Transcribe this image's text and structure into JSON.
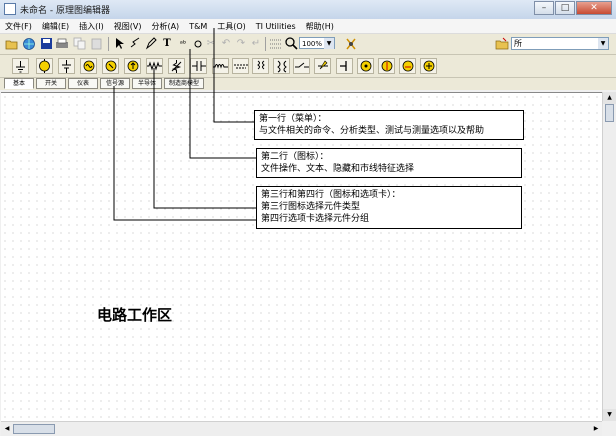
{
  "window": {
    "title": "未命名 - 原理图编辑器",
    "buttons": [
      "–",
      "□",
      "✕"
    ]
  },
  "menu": [
    "文件(F)",
    "编辑(E)",
    "插入(I)",
    "视图(V)",
    "分析(A)",
    "T&M",
    "工具(O)",
    "TI Utilities",
    "帮助(H)"
  ],
  "toolbar": {
    "zoom_value": "100%",
    "combo_value": "所"
  },
  "tabs": [
    "基本",
    "开关",
    "仪表",
    "信号源",
    "半导体",
    "制造商模型"
  ],
  "callouts": {
    "row1": {
      "title": "第一行（菜单）：",
      "text": "与文件相关的命令、分析类型、测试与测量选项以及帮助"
    },
    "row2": {
      "title": "第二行（图标）：",
      "text": "文件操作、文本、隐藏和市线特征选择"
    },
    "row34": {
      "title": "第三行和第四行（图标和选项卡）：",
      "line2": "第三行图标选择元件类型",
      "line3": "第四行选项卡选择元件分组"
    }
  },
  "workarea_label": "电路工作区"
}
